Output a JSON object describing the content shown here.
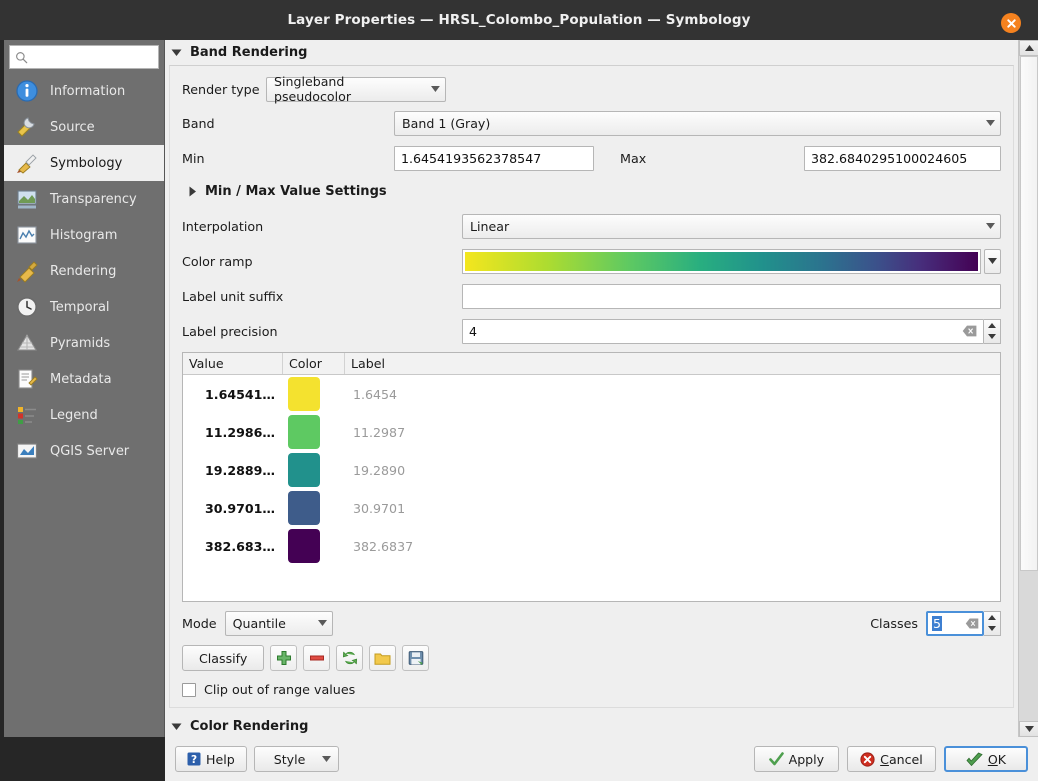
{
  "window": {
    "title": "Layer Properties — HRSL_Colombo_Population — Symbology",
    "close_label": "✕",
    "accent_close": "#f5821f",
    "focus_color": "#4a90d9"
  },
  "sidebar": {
    "search": {
      "value": "",
      "placeholder": "",
      "icon": "search-icon"
    },
    "items": [
      {
        "label": "Information",
        "icon": "information-icon",
        "selected": false
      },
      {
        "label": "Source",
        "icon": "source-icon",
        "selected": false
      },
      {
        "label": "Symbology",
        "icon": "symbology-icon",
        "selected": true
      },
      {
        "label": "Transparency",
        "icon": "transparency-icon",
        "selected": false
      },
      {
        "label": "Histogram",
        "icon": "histogram-icon",
        "selected": false
      },
      {
        "label": "Rendering",
        "icon": "rendering-icon",
        "selected": false
      },
      {
        "label": "Temporal",
        "icon": "temporal-icon",
        "selected": false
      },
      {
        "label": "Pyramids",
        "icon": "pyramids-icon",
        "selected": false
      },
      {
        "label": "Metadata",
        "icon": "metadata-icon",
        "selected": false
      },
      {
        "label": "Legend",
        "icon": "legend-icon",
        "selected": false
      },
      {
        "label": "QGIS Server",
        "icon": "qgis-server-icon",
        "selected": false
      }
    ]
  },
  "band_rendering": {
    "section_title": "Band Rendering",
    "expanded": true,
    "render_type_label": "Render type",
    "render_type_value": "Singleband pseudocolor",
    "band_label": "Band",
    "band_value": "Band 1 (Gray)",
    "min_label": "Min",
    "min_value": "1.6454193562378547",
    "max_label": "Max",
    "max_value": "382.6840295100024605",
    "minmax_settings_title": "Min / Max Value Settings",
    "minmax_settings_expanded": false,
    "interpolation_label": "Interpolation",
    "interpolation_value": "Linear",
    "color_ramp_label": "Color ramp",
    "color_ramp_name": "viridis-inverted",
    "label_unit_suffix_label": "Label unit suffix",
    "label_unit_suffix_value": "",
    "label_precision_label": "Label precision",
    "label_precision_value": "4"
  },
  "class_table": {
    "columns": [
      "Value",
      "Color",
      "Label"
    ],
    "rows": [
      {
        "value": "1.64541…",
        "color": "#f4e22f",
        "label": "1.6454"
      },
      {
        "value": "11.2986…",
        "color": "#5ec962",
        "label": "11.2987"
      },
      {
        "value": "19.2889…",
        "color": "#21918c",
        "label": "19.2890"
      },
      {
        "value": "30.9701…",
        "color": "#3e5c8a",
        "label": "30.9701"
      },
      {
        "value": "382.683…",
        "color": "#440154",
        "label": "382.6837"
      }
    ]
  },
  "controls": {
    "mode_label": "Mode",
    "mode_value": "Quantile",
    "classes_label": "Classes",
    "classes_value": "5",
    "classify_label": "Classify",
    "tool_buttons": [
      {
        "name": "add-class-button",
        "icon": "plus-icon"
      },
      {
        "name": "remove-class-button",
        "icon": "minus-icon"
      },
      {
        "name": "reload-button",
        "icon": "refresh-icon"
      },
      {
        "name": "load-ramp-button",
        "icon": "folder-icon"
      },
      {
        "name": "save-ramp-button",
        "icon": "save-icon"
      }
    ],
    "clip_label": "Clip out of range values",
    "clip_checked": false
  },
  "color_rendering": {
    "section_title": "Color Rendering",
    "expanded": true
  },
  "footer": {
    "help_label": "Help",
    "style_label": "Style",
    "apply_label": "Apply",
    "cancel_label": "Cancel",
    "ok_label": "OK"
  }
}
